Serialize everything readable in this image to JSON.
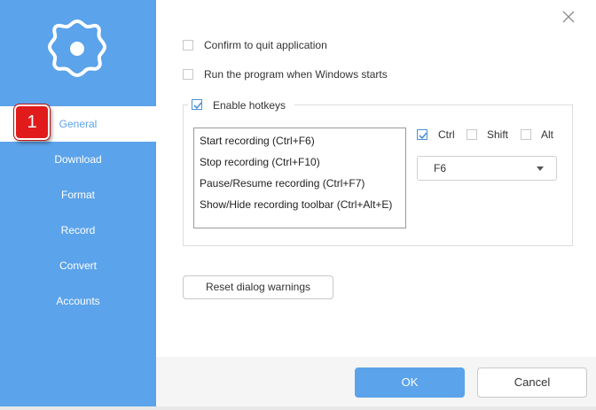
{
  "sidebar": {
    "logo_icon": "gear-icon",
    "items": [
      {
        "label": "General",
        "active": true
      },
      {
        "label": "Download",
        "active": false
      },
      {
        "label": "Format",
        "active": false
      },
      {
        "label": "Record",
        "active": false
      },
      {
        "label": "Convert",
        "active": false
      },
      {
        "label": "Accounts",
        "active": false
      }
    ],
    "annotation_badge": "1"
  },
  "window": {
    "close_icon": "close-icon"
  },
  "options": {
    "confirm_quit": {
      "label": "Confirm to quit application",
      "checked": false
    },
    "run_at_startup": {
      "label": "Run the program when Windows starts",
      "checked": false
    }
  },
  "hotkeys": {
    "enable": {
      "label": "Enable hotkeys",
      "checked": true
    },
    "list": [
      "Start recording (Ctrl+F6)",
      "Stop recording (Ctrl+F10)",
      "Pause/Resume recording (Ctrl+F7)",
      "Show/Hide recording toolbar (Ctrl+Alt+E)"
    ],
    "modifiers": {
      "ctrl": {
        "label": "Ctrl",
        "checked": true
      },
      "shift": {
        "label": "Shift",
        "checked": false
      },
      "alt": {
        "label": "Alt",
        "checked": false
      }
    },
    "key_select": {
      "value": "F6"
    }
  },
  "buttons": {
    "reset": "Reset dialog warnings",
    "ok": "OK",
    "cancel": "Cancel"
  },
  "colors": {
    "accent": "#5ba3ea",
    "badge": "#e11b1b"
  }
}
